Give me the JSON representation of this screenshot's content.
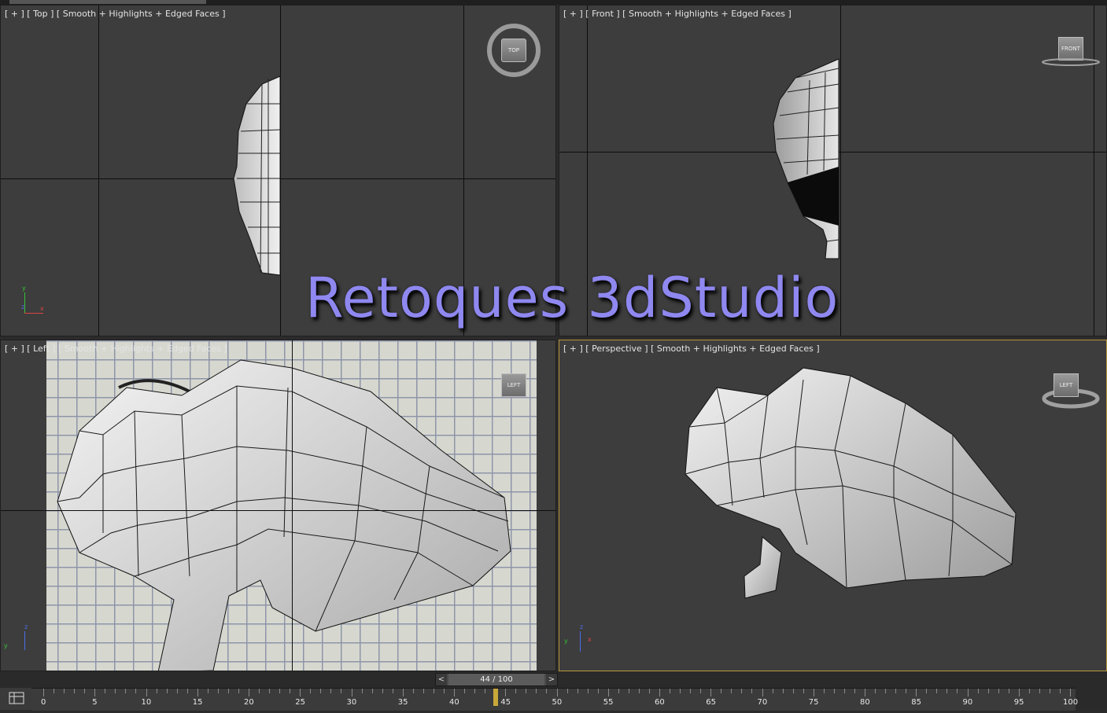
{
  "viewports": {
    "top": {
      "label": "[ + ] [ Top ] [ Smooth + Highlights + Edged Faces ]",
      "cube": "TOP"
    },
    "front": {
      "label": "[ + ] [ Front ] [ Smooth + Highlights + Edged Faces ]",
      "cube": "FRONT"
    },
    "left": {
      "label": "[ + ] [ Left ] [ Smooth + Highlights + Edged Faces ]",
      "cube": "LEFT"
    },
    "perspective": {
      "label": "[ + ] [ Perspective ] [ Smooth + Highlights + Edged Faces ]",
      "cube": "LEFT"
    }
  },
  "overlay": {
    "title": "Retoques 3dStudio"
  },
  "axes": {
    "x": "x",
    "y": "y",
    "z": "z"
  },
  "timeline": {
    "frame_display": "44 / 100",
    "prev": "<",
    "next": ">",
    "current_frame": 44,
    "max_frame": 100,
    "tick_labels": [
      "0",
      "5",
      "10",
      "15",
      "20",
      "25",
      "30",
      "35",
      "40",
      "45",
      "50",
      "55",
      "60",
      "65",
      "70",
      "75",
      "80",
      "85",
      "90",
      "95",
      "100"
    ]
  },
  "colors": {
    "active_border": "#b8963a",
    "title": "#8f88f0",
    "viewport_bg": "#3d3d3d"
  }
}
